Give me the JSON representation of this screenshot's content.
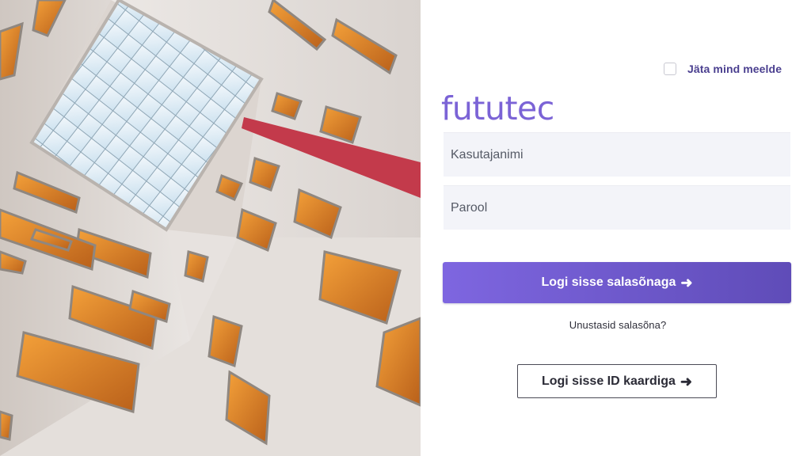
{
  "remember_me": {
    "label": "Jäta mind meelde",
    "checked": false
  },
  "brand": {
    "logo_text": "fututec"
  },
  "form": {
    "username_placeholder": "Kasutajanimi",
    "password_placeholder": "Parool"
  },
  "actions": {
    "login_password_label": "Logi sisse salasõnaga",
    "forgot_password_label": "Unustasid salasõna?",
    "login_idcard_label": "Logi sisse ID kaardiga",
    "arrow_glyph": "➜"
  },
  "colors": {
    "accent": "#7b63d6",
    "button_gradient_start": "#7e66e0",
    "button_gradient_end": "#5f4cb8",
    "remember_label": "#4a3f8f"
  },
  "icons": [
    "checkbox-icon",
    "arrow-right-icon"
  ]
}
